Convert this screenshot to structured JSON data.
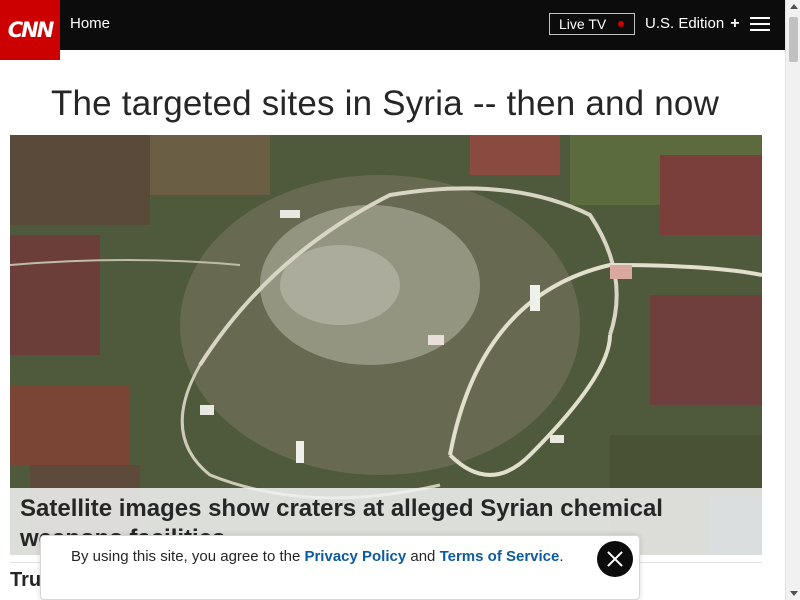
{
  "header": {
    "logo_text": "CNN",
    "home_label": "Home",
    "live_tv_label": "Live TV",
    "edition_label": "U.S. Edition",
    "edition_plus": "+",
    "colors": {
      "brand_red": "#cc0000",
      "bar_bg": "#0c0c0c"
    }
  },
  "article": {
    "headline": "The targeted sites in Syria -- then and now",
    "image_description_icon": "satellite-photo",
    "caption": "Satellite images show craters at alleged Syrian chemical weapons facilities",
    "next_section_partial": "Tru"
  },
  "consent_banner": {
    "text_before": "By using this site, you agree to the ",
    "privacy_link": "Privacy Policy",
    "text_middle": " and ",
    "terms_link": "Terms of Service",
    "text_after": ".",
    "close_icon": "close-icon"
  }
}
